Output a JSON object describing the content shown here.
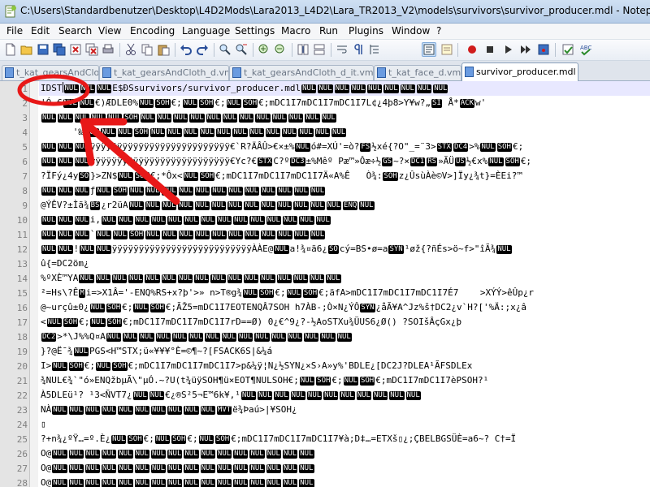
{
  "window": {
    "title": "C:\\Users\\Standardbenutzer\\Desktop\\L4D2Mods\\Lara2013_L4D2\\Lara_TR2013_V2\\models\\survivors\\survivor_producer.mdl - Notepad++"
  },
  "menu": [
    "File",
    "Edit",
    "Search",
    "View",
    "Encoding",
    "Language",
    "Settings",
    "Macro",
    "Run",
    "Plugins",
    "Window",
    "?"
  ],
  "toolbar": {
    "icons": [
      "new-file",
      "open-file",
      "save",
      "save-all",
      "close",
      "close-all",
      "print",
      "cut",
      "copy",
      "paste",
      "undo",
      "redo",
      "find",
      "replace",
      "zoom-in",
      "zoom-out",
      "sync-vertical",
      "sync-horizontal",
      "word-wrap",
      "show-all-chars",
      "indent-guide",
      "doc-map",
      "function-list",
      "record-macro",
      "stop-record",
      "play-macro",
      "run-macro-multiple",
      "save-macro",
      "spell-check",
      "spell-check-abc"
    ]
  },
  "tabs": [
    {
      "label": "t_kat_gearsAndCloth_d.vmt",
      "active": false
    },
    {
      "label": "t_kat_gearsAndCloth_d_it.vmt",
      "active": false
    },
    {
      "label": "t_kat_face_d.vmt",
      "active": false
    },
    {
      "label": "survivor_producer.mdl",
      "active": true
    }
  ],
  "editor": {
    "line_numbers": [
      "1",
      "2",
      "3",
      "4",
      "5",
      "6",
      "7",
      "8",
      "9",
      "10",
      "11",
      "12",
      "13",
      "14",
      "15",
      "16",
      "17",
      "18",
      "19",
      "20",
      "21",
      "22",
      "23",
      "24",
      "25",
      "26",
      "27",
      "28"
    ],
    "lines": [
      [
        {
          "t": "IDST"
        },
        {
          "caret": true
        },
        {
          "c": "NUL"
        },
        {
          "c": "NUL"
        },
        {
          "c": "NUL"
        },
        {
          "t": "E$ÐSsurvivors/survivor_producer.mdl"
        },
        {
          "c": "NUL"
        },
        {
          "c": "NUL"
        },
        {
          "c": "NUL"
        },
        {
          "c": "NUL"
        },
        {
          "c": "NUL"
        },
        {
          "c": "NUL"
        },
        {
          "c": "NUL"
        },
        {
          "c": "NUL"
        },
        {
          "c": "NUL"
        }
      ],
      [
        {
          "t": "'Ó €"
        },
        {
          "c": "NUL"
        },
        {
          "c": "NUL"
        },
        {
          "t": "€)"
        },
        {
          "t": "ÆDLE"
        },
        {
          "t": "0%"
        },
        {
          "c": "NUL"
        },
        {
          "c": "SOH"
        },
        {
          "t": "€;"
        },
        {
          "c": "NUL"
        },
        {
          "c": "SOH"
        },
        {
          "t": "€;"
        },
        {
          "c": "NUL"
        },
        {
          "c": "SOH"
        },
        {
          "t": "€;mDC1I7mDC1I7mDC1I7L¢¿4þ8>Y¥w?„"
        },
        {
          "c": "SI"
        },
        {
          "t": " Å*"
        },
        {
          "c": "ACK"
        },
        {
          "t": "w'"
        }
      ],
      [
        {
          "c": "NUL"
        },
        {
          "c": "NUL"
        },
        {
          "c": "NUL"
        },
        {
          "c": "NUL"
        },
        {
          "c": "NUL"
        },
        {
          "c": "SOH"
        },
        {
          "c": "NUL"
        },
        {
          "c": "NUL"
        },
        {
          "c": "NUL"
        },
        {
          "c": "NUL"
        },
        {
          "c": "NUL"
        },
        {
          "c": "NUL"
        },
        {
          "c": "NUL"
        },
        {
          "c": "NUL"
        },
        {
          "c": "NUL"
        },
        {
          "c": "NUL"
        },
        {
          "c": "NUL"
        },
        {
          "c": "NUL"
        }
      ],
      [
        {
          "t": "      '‰"
        },
        {
          "c": "NUL"
        },
        {
          "c": "NUL"
        },
        {
          "c": "NUL"
        },
        {
          "c": "SOH"
        },
        {
          "c": "NUL"
        },
        {
          "c": "NUL"
        },
        {
          "c": "NUL"
        },
        {
          "c": "NUL"
        },
        {
          "c": "NUL"
        },
        {
          "c": "NUL"
        },
        {
          "c": "NUL"
        },
        {
          "c": "NUL"
        },
        {
          "c": "NUL"
        },
        {
          "c": "NUL"
        },
        {
          "c": "NUL"
        },
        {
          "c": "NUL"
        }
      ],
      [
        {
          "c": "NUL"
        },
        {
          "c": "NUL"
        },
        {
          "c": "NUL"
        },
        {
          "t": "ÿÿÿÿÿÿÿÿÿÿÿÿÿÿÿÿÿÿÿÿÿÿÿÿÿÿ€`R?ÄÂÛ>€×±%"
        },
        {
          "c": "NUL"
        },
        {
          "t": "ó#=XÚ'=ò?"
        },
        {
          "c": "FS"
        },
        {
          "t": "½xé{?O\"_=¨3>"
        },
        {
          "c": "STX"
        },
        {
          "c": "DC4"
        },
        {
          "t": ">%"
        },
        {
          "c": "NUL"
        },
        {
          "c": "SOH"
        },
        {
          "t": "€;"
        }
      ],
      [
        {
          "c": "NUL"
        },
        {
          "c": "NUL"
        },
        {
          "c": "NUL"
        },
        {
          "t": "ÿÿÿÿÿÿÿÿÿÿÿÿÿÿÿÿÿÿÿÿÿÿÿÿÿÿ€Yc?€"
        },
        {
          "c": "STX"
        },
        {
          "t": "C?º"
        },
        {
          "c": "DC3"
        },
        {
          "t": "±%Mêº Pæ™»Ôæ÷½"
        },
        {
          "c": "GS"
        },
        {
          "t": "~?×"
        },
        {
          "c": "DC1"
        },
        {
          "c": "RS"
        },
        {
          "t": "»ÃÜ"
        },
        {
          "c": "US"
        },
        {
          "t": "½€x%"
        },
        {
          "c": "NUL"
        },
        {
          "c": "SOH"
        },
        {
          "t": "€;"
        }
      ],
      [
        {
          "t": "?ÏFý¿4y"
        },
        {
          "c": "SO"
        },
        {
          "t": "}>ZN$"
        },
        {
          "c": "NUL"
        },
        {
          "c": "SOH"
        },
        {
          "t": "€;*Ôx<"
        },
        {
          "c": "NUL"
        },
        {
          "c": "SOH"
        },
        {
          "t": "€;mDC1I7mDC1I7mDC1I7Ä«A%Ê   Ò¾:"
        },
        {
          "c": "SOH"
        },
        {
          "t": "z¿ÛsùÀè©V>]Ïy¿¾t}=ÈEi?™"
        }
      ],
      [
        {
          "c": "NUL"
        },
        {
          "c": "NUL"
        },
        {
          "c": "NUL"
        },
        {
          "t": "ƒ"
        },
        {
          "c": "NUL"
        },
        {
          "c": "SOH"
        },
        {
          "c": "NUL"
        },
        {
          "c": "NUL"
        },
        {
          "c": "NUL"
        },
        {
          "c": "NUL"
        },
        {
          "c": "NUL"
        },
        {
          "c": "NUL"
        },
        {
          "c": "NUL"
        },
        {
          "c": "NUL"
        },
        {
          "c": "NUL"
        },
        {
          "c": "NUL"
        },
        {
          "c": "NUL"
        },
        {
          "c": "NUL"
        }
      ],
      [
        {
          "t": "@ÝÊV?±Ìã¾"
        },
        {
          "c": "BS"
        },
        {
          "t": "¿r2üA"
        },
        {
          "c": "NUL"
        },
        {
          "c": "NUL"
        },
        {
          "c": "NUL"
        },
        {
          "c": "NUL"
        },
        {
          "c": "NUL"
        },
        {
          "c": "NUL"
        },
        {
          "c": "NUL"
        },
        {
          "c": "NUL"
        },
        {
          "c": "NUL"
        },
        {
          "c": "NUL"
        },
        {
          "c": "NUL"
        },
        {
          "c": "NUL"
        },
        {
          "c": "NUL"
        },
        {
          "c": "ENQ"
        },
        {
          "c": "NUL"
        }
      ],
      [
        {
          "c": "NUL"
        },
        {
          "c": "NUL"
        },
        {
          "c": "NUL"
        },
        {
          "t": "i,"
        },
        {
          "c": "NUL"
        },
        {
          "c": "NUL"
        },
        {
          "c": "NUL"
        },
        {
          "c": "NUL"
        },
        {
          "c": "NUL"
        },
        {
          "c": "NUL"
        },
        {
          "c": "NUL"
        },
        {
          "c": "NUL"
        },
        {
          "c": "NUL"
        },
        {
          "c": "NUL"
        },
        {
          "c": "NUL"
        },
        {
          "c": "NUL"
        },
        {
          "c": "NUL"
        },
        {
          "c": "NUL"
        }
      ],
      [
        {
          "c": "NUL"
        },
        {
          "c": "NUL"
        },
        {
          "c": "NUL"
        },
        {
          "t": "`"
        },
        {
          "c": "NUL"
        },
        {
          "c": "NUL"
        },
        {
          "c": "SOH"
        },
        {
          "c": "NUL"
        },
        {
          "c": "NUL"
        },
        {
          "c": "NUL"
        },
        {
          "c": "NUL"
        },
        {
          "c": "NUL"
        },
        {
          "c": "NUL"
        },
        {
          "c": "NUL"
        },
        {
          "c": "NUL"
        },
        {
          "c": "NUL"
        },
        {
          "c": "NUL"
        },
        {
          "c": "NUL"
        }
      ],
      [
        {
          "c": "NUL"
        },
        {
          "c": "NUL"
        },
        {
          "t": "!"
        },
        {
          "c": "NUL"
        },
        {
          "c": "NUL"
        },
        {
          "t": "ÿÿÿÿÿÿÿÿÿÿÿÿÿÿÿÿÿÿÿÿÿÿÿÿÿÿÀÀE@"
        },
        {
          "c": "NUL"
        },
        {
          "t": "a!¾¤ä6¿"
        },
        {
          "c": "SO"
        },
        {
          "t": "cý=BS•ø=a"
        },
        {
          "c": "SYN"
        },
        {
          "t": "¹øž{?ñÉs>ö~f>\"îÃ¾"
        },
        {
          "c": "NUL"
        }
      ],
      [
        {
          "t": "û{=DC2öm¿"
        }
      ],
      [
        {
          "t": "%ºXÈ™YA"
        },
        {
          "c": "NUL"
        },
        {
          "c": "NUL"
        },
        {
          "c": "NUL"
        },
        {
          "c": "NUL"
        },
        {
          "c": "NUL"
        },
        {
          "c": "NUL"
        },
        {
          "c": "NUL"
        },
        {
          "c": "NUL"
        },
        {
          "c": "NUL"
        },
        {
          "c": "NUL"
        },
        {
          "c": "NUL"
        },
        {
          "c": "NUL"
        },
        {
          "c": "NUL"
        },
        {
          "c": "NUL"
        },
        {
          "c": "NUL"
        },
        {
          "c": "NUL"
        }
      ],
      [
        {
          "t": "²=Hs\\?Ê"
        },
        {
          "c": "M"
        },
        {
          "t": "i=>X1Â='-ENQ%RS+x?þ'>» n>T®g¾"
        },
        {
          "c": "NUL"
        },
        {
          "c": "SOH"
        },
        {
          "t": "€;"
        },
        {
          "c": "NUL"
        },
        {
          "c": "SOH"
        },
        {
          "t": "€;äfA>mDC1I7mDC1I7mDC1I7É7    >XÝÝ>êÛp¿r"
        }
      ],
      [
        {
          "t": "@~urçû±0¿"
        },
        {
          "c": "NUL"
        },
        {
          "c": "SOH"
        },
        {
          "t": "€;"
        },
        {
          "c": "NUL"
        },
        {
          "c": "SOH"
        },
        {
          "t": "€;ÃŽ5=mDC1I7EOTENQÂ7SOH h7ÀB-;Ò×N¿ÝÔ"
        },
        {
          "c": "SYN"
        },
        {
          "t": "¿åÃ¥A^Jz%š†DC2¿v`H?['%Ä:;x¿â"
        }
      ],
      [
        {
          "t": "<"
        },
        {
          "c": "NUL"
        },
        {
          "c": "SOH"
        },
        {
          "t": "€;"
        },
        {
          "c": "NUL"
        },
        {
          "c": "SOH"
        },
        {
          "t": "€;mDC1I7mDC1I7mDC1I7rD==Ø) 0¿€^9¿?-½AoSTXu¾ÜUS6¿Ø() ?SOIšÂçGx¿þ"
        }
      ],
      [
        {
          "c": "DC2"
        },
        {
          "t": ">*\\J%%Q¤A"
        },
        {
          "c": "NUL"
        },
        {
          "c": "NUL"
        },
        {
          "c": "NUL"
        },
        {
          "c": "NUL"
        },
        {
          "c": "NUL"
        },
        {
          "c": "NUL"
        },
        {
          "c": "NUL"
        },
        {
          "c": "NUL"
        },
        {
          "c": "NUL"
        },
        {
          "c": "NUL"
        },
        {
          "c": "NUL"
        },
        {
          "c": "NUL"
        },
        {
          "c": "NUL"
        },
        {
          "c": "NUL"
        },
        {
          "c": "NUL"
        }
      ],
      [
        {
          "t": "}?@Ë¯¾"
        },
        {
          "c": "NUL"
        },
        {
          "t": "PGS<H™STX;ü«¥¥¥°È=©¶~?[FSACK6S|&¼á"
        }
      ],
      [
        {
          "t": "I>"
        },
        {
          "c": "NUL"
        },
        {
          "c": "SOH"
        },
        {
          "t": "€;"
        },
        {
          "c": "NUL"
        },
        {
          "c": "SOH"
        },
        {
          "t": "€;mDC1I7mDC1I7mDC1I7>p&¼ÿ¦N¿½SYN¿×S›A»y%'BDLE¿[DC2J?DLEA¹ÃFSDLEx"
        }
      ],
      [
        {
          "t": "¾NUL€¾`\"ó»ENQžbµÃ\\\"µÓ.~?U(t¾üÿSOH¶ü×EOT¶NULSOH€;"
        },
        {
          "c": "NUL"
        },
        {
          "c": "SOH"
        },
        {
          "t": "€;"
        },
        {
          "c": "NUL"
        },
        {
          "c": "SOH"
        },
        {
          "t": "€;mDC1I7mDC1I7èPSOH?¹"
        }
      ],
      [
        {
          "t": "À5DLEü¹? ¹3<ÑVT7¿"
        },
        {
          "c": "NUL"
        },
        {
          "c": "NUL"
        },
        {
          "t": "€¿®S²5¬E™6k¥,¹"
        },
        {
          "c": "NUL"
        },
        {
          "c": "NUL"
        },
        {
          "c": "NUL"
        },
        {
          "c": "NUL"
        },
        {
          "c": "NUL"
        },
        {
          "c": "NUL"
        },
        {
          "c": "NUL"
        },
        {
          "c": "NUL"
        },
        {
          "c": "NUL"
        },
        {
          "c": "NUL"
        },
        {
          "c": "NUL"
        }
      ],
      [
        {
          "t": "NÀ"
        },
        {
          "c": "NUL"
        },
        {
          "c": "NUL"
        },
        {
          "c": "NUL"
        },
        {
          "c": "NUL"
        },
        {
          "c": "NUL"
        },
        {
          "c": "NUL"
        },
        {
          "c": "NUL"
        },
        {
          "c": "NUL"
        },
        {
          "c": "NUL"
        },
        {
          "c": "NUL"
        },
        {
          "c": "MVT"
        },
        {
          "t": "ë¾Þaú>|¥SOH¿"
        }
      ],
      [
        {
          "t": "▯"
        }
      ],
      [
        {
          "t": "?+n¾¿ºŸ…=º.È¿"
        },
        {
          "c": "NUL"
        },
        {
          "c": "SOH"
        },
        {
          "t": "€;"
        },
        {
          "c": "NUL"
        },
        {
          "c": "SOH"
        },
        {
          "t": "€;"
        },
        {
          "c": "NUL"
        },
        {
          "c": "SOH"
        },
        {
          "t": "€;mDC1I7mDC1I7mDC1I7¥à;D‡…=ETXš▯¿;ÇBELBGSÜÈ=a6~? C†=Ï"
        }
      ],
      [
        {
          "t": "O@"
        },
        {
          "c": "NUL"
        },
        {
          "c": "NUL"
        },
        {
          "c": "NUL"
        },
        {
          "c": "NUL"
        },
        {
          "c": "NUL"
        },
        {
          "c": "NUL"
        },
        {
          "c": "NUL"
        },
        {
          "c": "NUL"
        },
        {
          "c": "NUL"
        },
        {
          "c": "NUL"
        },
        {
          "c": "NUL"
        },
        {
          "c": "NUL"
        },
        {
          "c": "NUL"
        },
        {
          "c": "NUL"
        },
        {
          "c": "NUL"
        },
        {
          "c": "NUL"
        }
      ],
      [
        {
          "t": "O@"
        },
        {
          "c": "NUL"
        },
        {
          "c": "NUL"
        },
        {
          "c": "NUL"
        },
        {
          "c": "NUL"
        },
        {
          "c": "NUL"
        },
        {
          "c": "NUL"
        },
        {
          "c": "NUL"
        },
        {
          "c": "NUL"
        },
        {
          "c": "NUL"
        },
        {
          "c": "NUL"
        },
        {
          "c": "NUL"
        },
        {
          "c": "NUL"
        },
        {
          "c": "NUL"
        },
        {
          "c": "NUL"
        },
        {
          "c": "NUL"
        },
        {
          "c": "NUL"
        }
      ],
      [
        {
          "t": "O@"
        },
        {
          "c": "NUL"
        },
        {
          "c": "NUL"
        },
        {
          "c": "NUL"
        },
        {
          "c": "NUL"
        },
        {
          "c": "NUL"
        },
        {
          "c": "NUL"
        },
        {
          "c": "NUL"
        },
        {
          "c": "NUL"
        },
        {
          "c": "NUL"
        },
        {
          "c": "NUL"
        },
        {
          "c": "NUL"
        },
        {
          "c": "NUL"
        },
        {
          "c": "NUL"
        },
        {
          "c": "NUL"
        },
        {
          "c": "NUL"
        },
        {
          "c": "NUL"
        }
      ]
    ]
  },
  "annotation": {
    "color": "#e81818"
  },
  "colors": {
    "titlebar": "#c4d7ee",
    "gutter": "#e4e4e4",
    "current_line": "#e8e8ff",
    "control_char_bg": "#000000"
  }
}
